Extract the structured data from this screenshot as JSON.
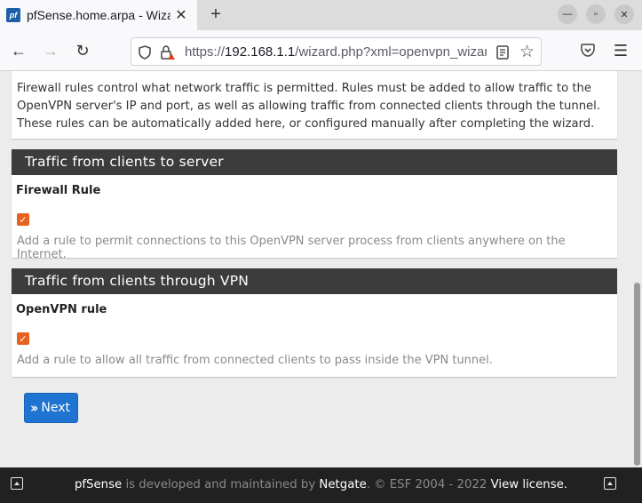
{
  "browser": {
    "tab_title": "pfSense.home.arpa - Wizard",
    "favicon_text": "pf",
    "url_prefix": "https://",
    "url_host": "192.168.1.1",
    "url_path": "/wizard.php?xml=openvpn_wizard.xml"
  },
  "intro": {
    "text": "Firewall rules control what network traffic is permitted. Rules must be added to allow traffic to the OpenVPN server's IP and port, as well as allowing traffic from connected clients through the tunnel. These rules can be automatically added here, or configured manually after completing the wizard."
  },
  "sections": [
    {
      "title": "Traffic from clients to server",
      "field_label": "Firewall Rule",
      "checked": true,
      "help": "Add a rule to permit connections to this OpenVPN server process from clients anywhere on the Internet."
    },
    {
      "title": "Traffic from clients through VPN",
      "field_label": "OpenVPN rule",
      "checked": true,
      "help": "Add a rule to allow all traffic from connected clients to pass inside the VPN tunnel."
    }
  ],
  "next_button": {
    "label": "Next",
    "icon": "double-chevron-right-icon"
  },
  "footer": {
    "brand": "pfSense",
    "text1": " is developed and maintained by ",
    "company": "Netgate",
    "text2": ". © ESF 2004 - 2022 ",
    "license": "View license."
  },
  "colors": {
    "accent": "#e8611d",
    "panel_header": "#3c3c3c",
    "button": "#1e74d0",
    "footer": "#212121"
  }
}
